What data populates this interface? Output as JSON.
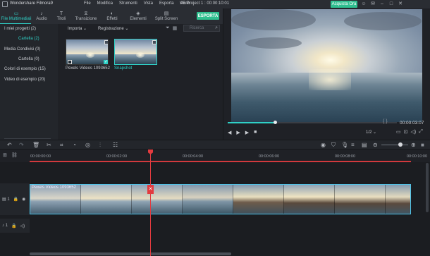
{
  "titlebar": {
    "app_name": "Wondershare Filmora9",
    "menu": [
      "File",
      "Modifica",
      "Strumenti",
      "Vista",
      "Esporta",
      "Aiuto"
    ],
    "project": "VE Project 1 : 00:00:10:01",
    "buy_label": "Acquista Ora"
  },
  "tabs": [
    {
      "label": "File Multimediali",
      "icon": "folder-icon"
    },
    {
      "label": "Audio",
      "icon": "music-icon"
    },
    {
      "label": "Titoli",
      "icon": "title-icon"
    },
    {
      "label": "Transizione",
      "icon": "transition-icon"
    },
    {
      "label": "Effetti",
      "icon": "effects-icon"
    },
    {
      "label": "Elementi",
      "icon": "elements-icon"
    },
    {
      "label": "Split Screen",
      "icon": "split-screen-icon"
    }
  ],
  "export_label": "ESPORTA",
  "sidebar": {
    "items": [
      {
        "label": "I miei progetti (2)"
      },
      {
        "label": "Cartella (2)"
      },
      {
        "label": "Media Condivisi (0)"
      },
      {
        "label": "Cartella (0)"
      },
      {
        "label": "Colori di esempio (15)"
      },
      {
        "label": "Video di esempio (20)"
      }
    ]
  },
  "media": {
    "import_label": "Importa",
    "record_label": "Registrazione",
    "search_placeholder": "Ricerca",
    "items": [
      {
        "label": "Pexels Videos 1093652"
      },
      {
        "label": "Snapshot"
      }
    ]
  },
  "preview": {
    "timecode": "00:00:03:07",
    "ratio": "1/2",
    "progress_fraction": 0.28
  },
  "timeline": {
    "ticks": [
      "00:00:00:00",
      "00:00:02:00",
      "00:00:04:00",
      "00:00:06:00",
      "00:00:08:00",
      "00:00:10:00"
    ],
    "clip_label": "Pexels Videos 1093652",
    "video_track_label": "1",
    "audio_track_label": "1"
  }
}
